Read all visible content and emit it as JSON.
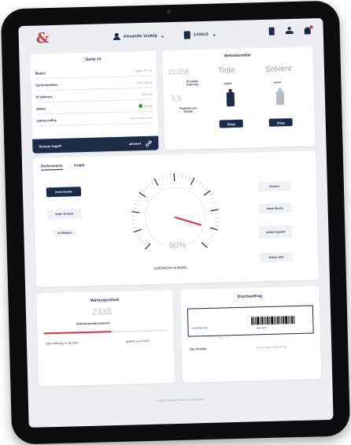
{
  "app": {
    "logo": "&",
    "user_name": "Alexander Gnabig",
    "device_name": "JANUS"
  },
  "geraet": {
    "title": "Gerät #3",
    "rows": [
      {
        "label": "Modell",
        "value": "alpha-ST xx"
      },
      {
        "label": "Seriennummer",
        "value": "xxxx-xxxxx"
      },
      {
        "label": "IP-Adresse",
        "value": "xxx.xxx"
      },
      {
        "label": "Status",
        "value": "online"
      },
      {
        "label": "zuletzt online",
        "value": "xx.xx.xxxx xx:xx"
      }
    ],
    "remote_label": "Remote Zugriff",
    "remote_value": "aktiviert"
  },
  "betriebsmittel": {
    "title": "Betriebsmittel",
    "printed_count": "15.258",
    "printed_label": "Produkte bedruckt",
    "per_hour": "5,5",
    "per_hour_label": "Produkte pro Stunde",
    "ink": {
      "name": "Tinte",
      "sub": "xxxml",
      "shop": "Shop"
    },
    "solvent": {
      "name": "Solvent",
      "sub": "xxxml",
      "shop": "Shop"
    },
    "ink_color": "#1c2b4a",
    "solvent_color": "#b8bcc3",
    "ink_level_pct": 100,
    "solvent_level_pct": 100
  },
  "performance": {
    "tabs": [
      "Performance",
      "Graph"
    ],
    "left_buttons": [
      "letzte Stunde",
      "letzte Schicht"
    ],
    "left_select": "xx Minuten",
    "right_buttons": [
      "Gestern",
      "letzte Woche",
      "letztes Quartal",
      "letztes Jahr"
    ],
    "gauge_value": "90%",
    "gauge_level_pct": 90,
    "date_range": "xx.08.2021 bis xx.08.2021"
  },
  "wartung": {
    "title": "Wartungsstand",
    "number": "2333",
    "sub": "Betriebsstunden (optimal",
    "progress_pct": 55,
    "last_label": "letzte Wartung: xx.08.2020",
    "planned_label": "geplant: xx.xx.2021"
  },
  "druckauftrag": {
    "title": "Druckauftrag",
    "label_text": "Laserdruck xxx",
    "label_code": "xxxx-xxxx",
    "count_label": "Stk. Produkt",
    "count_value": "xxx/xxx aus Druckauftrag"
  },
  "footer": "© 2021 Gnabig & Nauer Gnabig GmbH",
  "colors": {
    "accent": "#d9333e",
    "navy": "#1c2b4a",
    "status_online": "#27a83a"
  }
}
